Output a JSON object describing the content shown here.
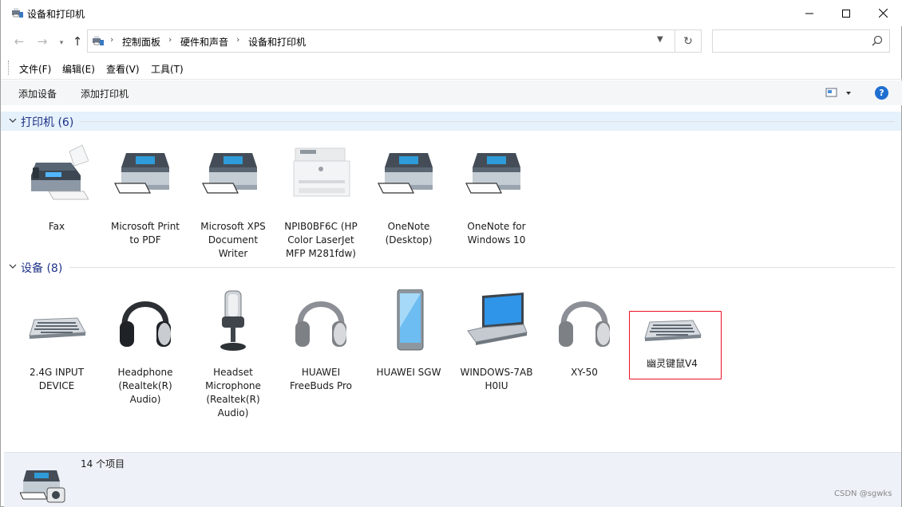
{
  "window": {
    "title": "设备和打印机"
  },
  "address": {
    "crumbs": [
      "控制面板",
      "硬件和声音",
      "设备和打印机"
    ],
    "search_placeholder": ""
  },
  "menu": [
    "文件(F)",
    "编辑(E)",
    "查看(V)",
    "工具(T)"
  ],
  "commands": {
    "add_device": "添加设备",
    "add_printer": "添加打印机"
  },
  "groups": {
    "printers": {
      "title": "打印机 (6)",
      "items": [
        {
          "label": "Fax",
          "icon": "fax-icon"
        },
        {
          "label": "Microsoft Print\nto PDF",
          "icon": "printer-icon"
        },
        {
          "label": "Microsoft XPS\nDocument\nWriter",
          "icon": "printer-icon"
        },
        {
          "label": "NPIB0BF6C (HP\nColor LaserJet\nMFP M281fdw)",
          "icon": "laser-printer-icon"
        },
        {
          "label": "OneNote\n(Desktop)",
          "icon": "printer-icon"
        },
        {
          "label": "OneNote for\nWindows 10",
          "icon": "printer-icon"
        }
      ]
    },
    "devices": {
      "title": "设备 (8)",
      "items": [
        {
          "label": "2.4G INPUT\nDEVICE",
          "icon": "keyboard-icon"
        },
        {
          "label": "Headphone\n(Realtek(R)\nAudio)",
          "icon": "headphone-icon"
        },
        {
          "label": "Headset\nMicrophone\n(Realtek(R)\nAudio)",
          "icon": "microphone-icon"
        },
        {
          "label": "HUAWEI\nFreeBuds Pro",
          "icon": "headphone-icon"
        },
        {
          "label": "HUAWEI SGW",
          "icon": "phone-icon"
        },
        {
          "label": "WINDOWS-7AB\nH0IU",
          "icon": "laptop-icon"
        },
        {
          "label": "XY-50",
          "icon": "headphone-icon"
        },
        {
          "label": "幽灵键鼠V4",
          "icon": "keyboard-icon",
          "selected": true
        }
      ]
    }
  },
  "details": {
    "count": "14 个项目"
  },
  "watermark": "CSDN @sgwks",
  "colors": {
    "accent": "#1e3287",
    "selection_border": "#e81123",
    "header_bg": "#e5f1fb"
  }
}
